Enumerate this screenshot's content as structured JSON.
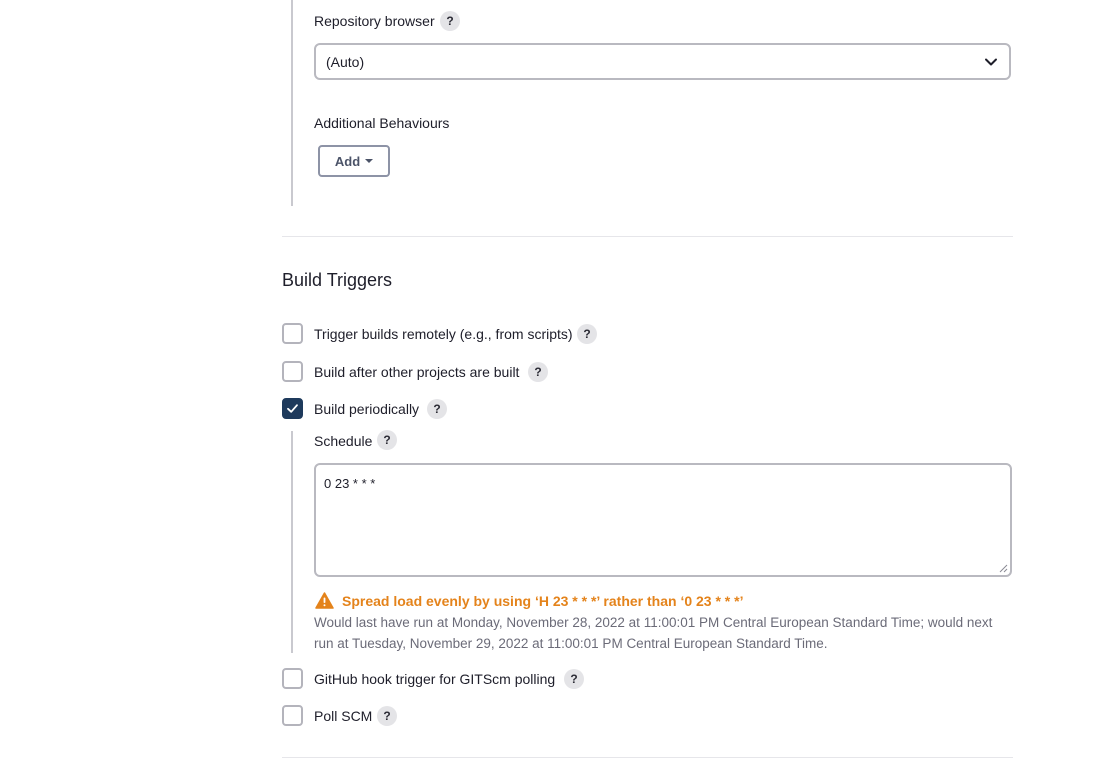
{
  "scm": {
    "repository_browser_label": "Repository browser",
    "repository_browser_value": "(Auto)",
    "additional_behaviours_label": "Additional Behaviours",
    "add_button_label": "Add"
  },
  "help_icon_text": "?",
  "build_triggers": {
    "title": "Build Triggers",
    "options": [
      {
        "label": "Trigger builds remotely (e.g., from scripts)",
        "checked": false
      },
      {
        "label": "Build after other projects are built",
        "checked": false
      },
      {
        "label": "Build periodically",
        "checked": true
      },
      {
        "label": "GitHub hook trigger for GITScm polling",
        "checked": false
      },
      {
        "label": "Poll SCM",
        "checked": false
      }
    ],
    "schedule": {
      "label": "Schedule",
      "value": "0 23 * * *",
      "warning": "Spread load evenly by using ‘H 23 * * *’ rather than ‘0 23 * * *’",
      "info": "Would last have run at Monday, November 28, 2022 at 11:00:01 PM Central European Standard Time; would next run at Tuesday, November 29, 2022 at 11:00:01 PM Central European Standard Time."
    }
  },
  "colors": {
    "checkbox_checked": "#1e3a5c",
    "warning": "#e4831b",
    "help_bg": "#e4e4e7"
  },
  "icons": [
    "chevron-down-icon",
    "caret-down-icon",
    "help-icon",
    "checkmark-icon",
    "warning-icon",
    "resize-grip-icon"
  ]
}
